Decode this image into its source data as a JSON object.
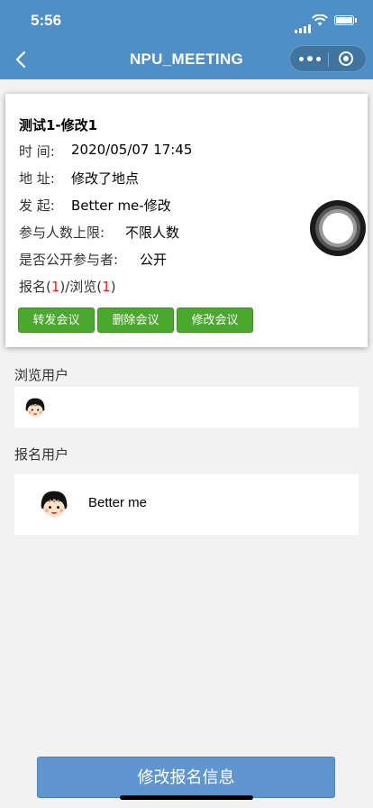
{
  "status_bar": {
    "time": "5:56"
  },
  "nav": {
    "title": "NPU_MEETING"
  },
  "meeting": {
    "title": "测试1-修改1",
    "time_label": "时  间:",
    "time_value": "2020/05/07 17:45",
    "place_label": "地  址:",
    "place_value": "修改了地点",
    "initiator_label": "发  起:",
    "initiator_value": "Better me-修改",
    "limit_label": "参与人数上限:",
    "limit_value": "不限人数",
    "public_label": "是否公开参与者:",
    "public_value": "公开",
    "signup_prefix": "报名(",
    "signup_count": "1",
    "signup_mid": ")/浏览(",
    "view_count": "1",
    "signup_suffix": ")",
    "buttons": [
      "转发会议",
      "删除会议",
      "修改会议"
    ]
  },
  "viewers": {
    "label": "浏览用户"
  },
  "registrants": {
    "label": "报名用户",
    "users": [
      {
        "name": "Better me"
      }
    ]
  },
  "bottom_button": {
    "label": "修改报名信息"
  },
  "colors": {
    "header": "#4f8fc6",
    "button_green": "#4aa82e",
    "bottom_button": "#5f96cf",
    "count_red": "#e0201e"
  }
}
